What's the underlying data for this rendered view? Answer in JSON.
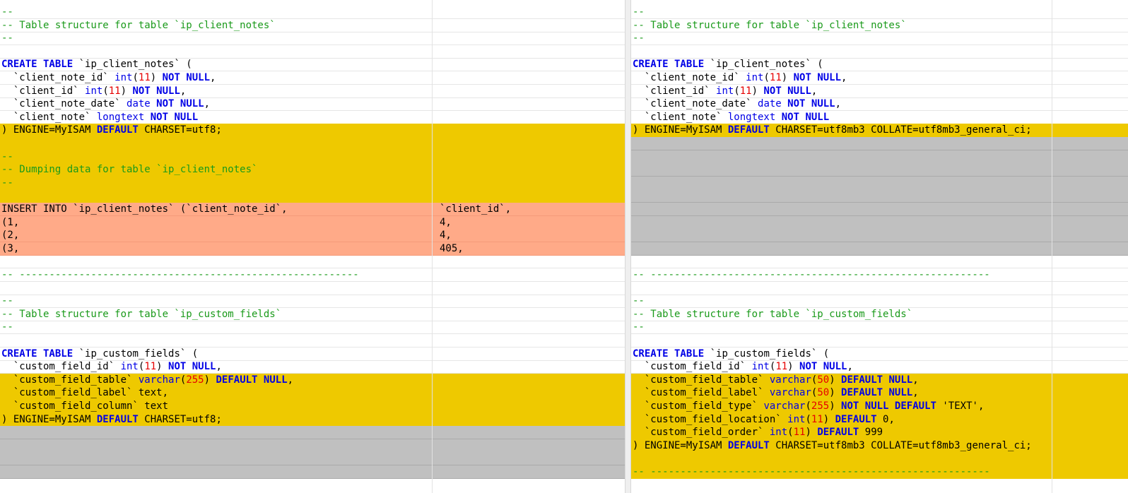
{
  "colors": {
    "modified_line": "#eec900",
    "deleted_line": "#ffaa88",
    "missing_line": "#c0c0c0",
    "keyword": "#0000e6",
    "comment": "#1a9a1a",
    "number": "#e60000"
  },
  "left": {
    "rows": [
      {
        "t": "cm",
        "text": "--"
      },
      {
        "t": "cm",
        "text": "-- Table structure for table `ip_client_notes`"
      },
      {
        "t": "cm",
        "text": "--"
      },
      {
        "t": "blank",
        "text": ""
      },
      {
        "t": "code",
        "text": "CREATE TABLE `ip_client_notes` ("
      },
      {
        "t": "code",
        "text": "  `client_note_id` int(11) NOT NULL,"
      },
      {
        "t": "code",
        "text": "  `client_id` int(11) NOT NULL,"
      },
      {
        "t": "code",
        "text": "  `client_note_date` date NOT NULL,"
      },
      {
        "t": "code",
        "text": "  `client_note` longtext NOT NULL"
      },
      {
        "t": "mod",
        "text": ") ENGINE=MyISAM DEFAULT CHARSET=utf8;"
      },
      {
        "t": "mod",
        "text": ""
      },
      {
        "t": "mod",
        "text": "--"
      },
      {
        "t": "mod",
        "text": "-- Dumping data for table `ip_client_notes`"
      },
      {
        "t": "mod",
        "text": "--"
      },
      {
        "t": "mod",
        "text": ""
      },
      {
        "t": "del",
        "text": "INSERT INTO `ip_client_notes` (`client_note_id`,",
        "text2": "`client_id`,"
      },
      {
        "t": "del",
        "text": "(1,",
        "text2": "4,"
      },
      {
        "t": "del",
        "text": "(2,",
        "text2": "4,"
      },
      {
        "t": "del",
        "text": "(3,",
        "text2": "405,"
      },
      {
        "t": "blank",
        "text": ""
      },
      {
        "t": "cm",
        "text": "-- ---------------------------------------------------------"
      },
      {
        "t": "blank",
        "text": ""
      },
      {
        "t": "cm",
        "text": "--"
      },
      {
        "t": "cm",
        "text": "-- Table structure for table `ip_custom_fields`"
      },
      {
        "t": "cm",
        "text": "--"
      },
      {
        "t": "blank",
        "text": ""
      },
      {
        "t": "code",
        "text": "CREATE TABLE `ip_custom_fields` ("
      },
      {
        "t": "code",
        "text": "  `custom_field_id` int(11) NOT NULL,"
      },
      {
        "t": "mod",
        "text": "  `custom_field_table` varchar(255) DEFAULT NULL,"
      },
      {
        "t": "mod",
        "text": "  `custom_field_label` text,"
      },
      {
        "t": "mod",
        "text": "  `custom_field_column` text"
      },
      {
        "t": "mod",
        "text": ") ENGINE=MyISAM DEFAULT CHARSET=utf8;"
      },
      {
        "t": "gap",
        "text": ""
      },
      {
        "t": "gap",
        "text": ""
      },
      {
        "t": "gap",
        "text": ""
      },
      {
        "t": "gap",
        "text": ""
      }
    ]
  },
  "right": {
    "rows": [
      {
        "t": "cm",
        "text": "--"
      },
      {
        "t": "cm",
        "text": "-- Table structure for table `ip_client_notes`"
      },
      {
        "t": "cm",
        "text": "--"
      },
      {
        "t": "blank",
        "text": ""
      },
      {
        "t": "code",
        "text": "CREATE TABLE `ip_client_notes` ("
      },
      {
        "t": "code",
        "text": "  `client_note_id` int(11) NOT NULL,"
      },
      {
        "t": "code",
        "text": "  `client_id` int(11) NOT NULL,"
      },
      {
        "t": "code",
        "text": "  `client_note_date` date NOT NULL,"
      },
      {
        "t": "code",
        "text": "  `client_note` longtext NOT NULL"
      },
      {
        "t": "mod",
        "text": ") ENGINE=MyISAM DEFAULT CHARSET=utf8mb3 COLLATE=utf8mb3_general_ci;"
      },
      {
        "t": "gap",
        "text": ""
      },
      {
        "t": "gap",
        "text": ""
      },
      {
        "t": "gap",
        "text": ""
      },
      {
        "t": "gap",
        "text": ""
      },
      {
        "t": "gap",
        "text": ""
      },
      {
        "t": "gap",
        "text": ""
      },
      {
        "t": "gap",
        "text": ""
      },
      {
        "t": "gap",
        "text": ""
      },
      {
        "t": "gap",
        "text": ""
      },
      {
        "t": "blank",
        "text": ""
      },
      {
        "t": "cm",
        "text": "-- ---------------------------------------------------------"
      },
      {
        "t": "blank",
        "text": ""
      },
      {
        "t": "cm",
        "text": "--"
      },
      {
        "t": "cm",
        "text": "-- Table structure for table `ip_custom_fields`"
      },
      {
        "t": "cm",
        "text": "--"
      },
      {
        "t": "blank",
        "text": ""
      },
      {
        "t": "code",
        "text": "CREATE TABLE `ip_custom_fields` ("
      },
      {
        "t": "code",
        "text": "  `custom_field_id` int(11) NOT NULL,"
      },
      {
        "t": "mod",
        "text": "  `custom_field_table` varchar(50) DEFAULT NULL,"
      },
      {
        "t": "mod",
        "text": "  `custom_field_label` varchar(50) DEFAULT NULL,"
      },
      {
        "t": "mod",
        "text": "  `custom_field_type` varchar(255) NOT NULL DEFAULT 'TEXT',"
      },
      {
        "t": "mod",
        "text": "  `custom_field_location` int(11) DEFAULT 0,"
      },
      {
        "t": "mod",
        "text": "  `custom_field_order` int(11) DEFAULT 999"
      },
      {
        "t": "mod",
        "text": ") ENGINE=MyISAM DEFAULT CHARSET=utf8mb3 COLLATE=utf8mb3_general_ci;"
      },
      {
        "t": "mod",
        "text": ""
      },
      {
        "t": "mod",
        "text": "-- ---------------------------------------------------------"
      }
    ]
  }
}
